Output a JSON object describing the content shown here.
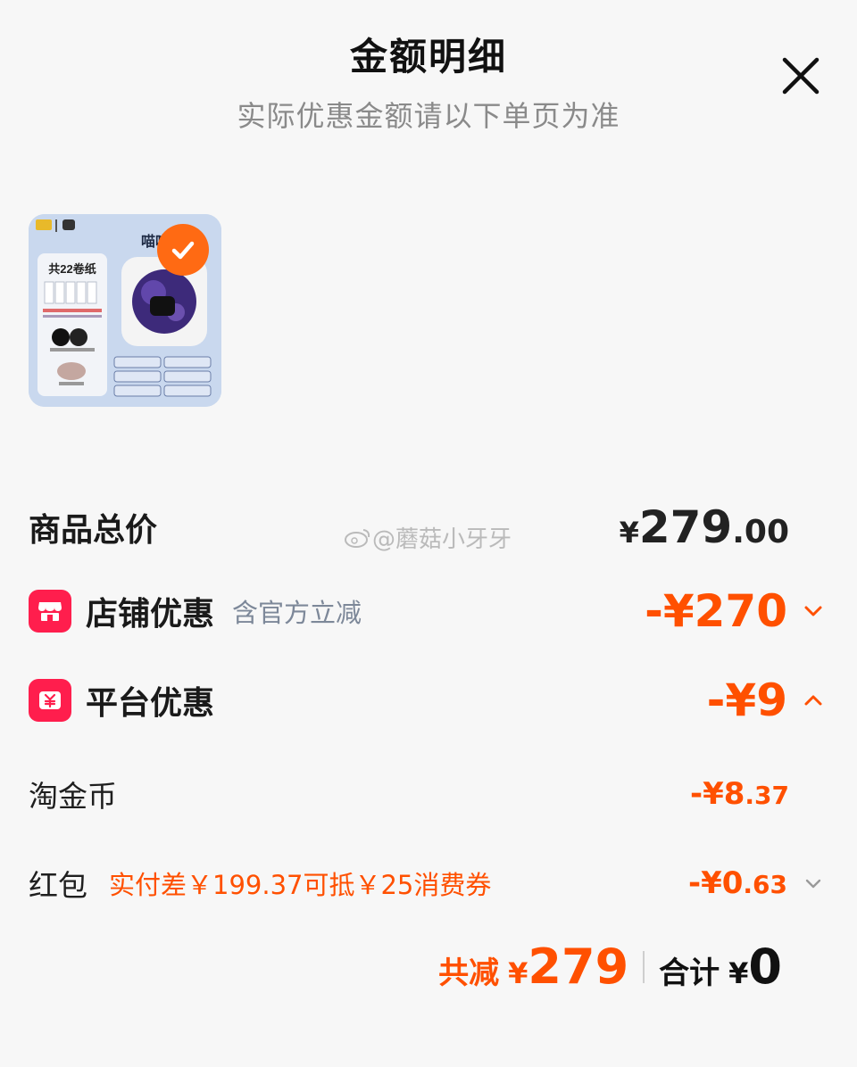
{
  "header": {
    "title": "金额明细",
    "subtitle": "实际优惠金额请以下单页为准"
  },
  "product": {
    "image_title": "喵喵机",
    "image_text": "共22卷纸"
  },
  "rows": {
    "total": {
      "label": "商品总价",
      "currency": "¥",
      "integer": "279",
      "decimal": ".00"
    },
    "store": {
      "label": "店铺优惠",
      "note": "含官方立减",
      "amount": "-¥270"
    },
    "platform": {
      "label": "平台优惠",
      "amount": "-¥9"
    },
    "coins": {
      "label": "淘金币",
      "amount_main": "-¥8",
      "amount_cents": ".37"
    },
    "redpacket": {
      "label": "红包",
      "note": "实付差￥199.37可抵￥25消费券",
      "amount_main": "-¥0",
      "amount_cents": ".63"
    }
  },
  "footer": {
    "reduce_label": "共减",
    "reduce_currency": "¥",
    "reduce_value": "279",
    "total_label": "合计",
    "total_currency": "¥",
    "total_value": "0"
  },
  "watermark": "@蘑菇小牙牙",
  "colors": {
    "accent": "#ff5000",
    "badge_red": "#ff1e4d",
    "check_orange": "#ff6a13"
  },
  "icons": {
    "close": "close-icon",
    "check": "check-icon",
    "store": "store-icon",
    "platform": "platform-coupon-icon",
    "chevron_down": "chevron-down-icon",
    "chevron_up": "chevron-up-icon"
  }
}
